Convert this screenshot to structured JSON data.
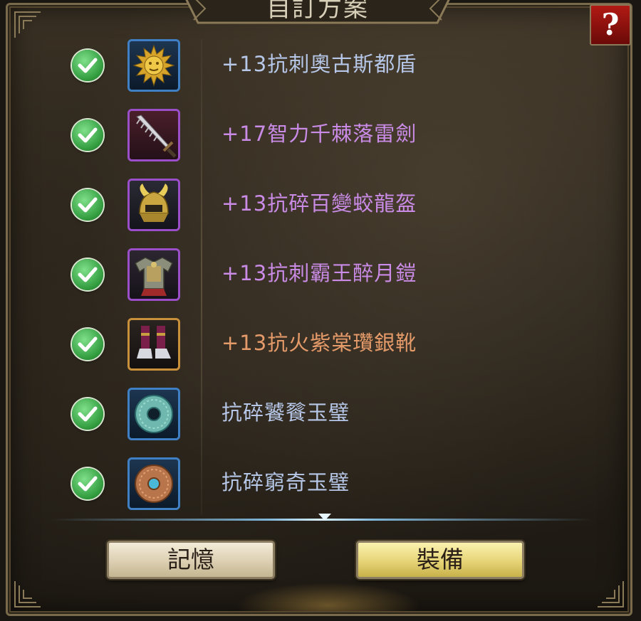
{
  "title": "自訂方案",
  "help_label": "?",
  "items": [
    {
      "name": "+13抗刺奧古斯都盾",
      "color": "#b6c7e8",
      "rarity": "blue",
      "icon": "sun-shield-icon"
    },
    {
      "name": "+17智力千棘落雷劍",
      "color": "#c98be6",
      "rarity": "purple",
      "icon": "sword-icon"
    },
    {
      "name": "+13抗碎百變蛟龍盔",
      "color": "#c98be6",
      "rarity": "purple",
      "icon": "dragon-helmet-icon"
    },
    {
      "name": "+13抗刺霸王醉月鎧",
      "color": "#c98be6",
      "rarity": "purple",
      "icon": "armor-icon"
    },
    {
      "name": "+13抗火紫棠瓚銀靴",
      "color": "#e59a6a",
      "rarity": "orange",
      "icon": "boots-icon"
    },
    {
      "name": "抗碎饕餮玉璧",
      "color": "#b6c7e8",
      "rarity": "blue",
      "icon": "jade-disc-icon"
    },
    {
      "name": "抗碎窮奇玉璧",
      "color": "#b6c7e8",
      "rarity": "blue",
      "icon": "bronze-disc-icon"
    }
  ],
  "buttons": {
    "memory": "記憶",
    "equip": "裝備"
  }
}
